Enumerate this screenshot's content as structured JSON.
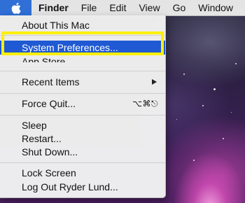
{
  "menubar": {
    "apple_icon": "apple-logo-icon",
    "items": [
      {
        "label": "Finder",
        "bold": true
      },
      {
        "label": "File"
      },
      {
        "label": "Edit"
      },
      {
        "label": "View"
      },
      {
        "label": "Go"
      },
      {
        "label": "Window"
      }
    ]
  },
  "apple_menu": {
    "items": [
      {
        "label": "About This Mac"
      },
      {
        "label": "System Preferences..."
      },
      {
        "label": "App Store..."
      },
      {
        "label": "Recent Items"
      },
      {
        "label": "Force Quit...",
        "shortcut": "⌥⌘⎋"
      },
      {
        "label": "Sleep"
      },
      {
        "label": "Restart..."
      },
      {
        "label": "Shut Down..."
      },
      {
        "label": "Lock Screen"
      },
      {
        "label": "Log Out Ryder Lund..."
      }
    ],
    "selected_item": "System Preferences...",
    "highlight_color": "#1f59d3",
    "annotation_color": "#ffef00"
  },
  "desktop": {
    "wallpaper": "purple-nebula-galaxy"
  }
}
